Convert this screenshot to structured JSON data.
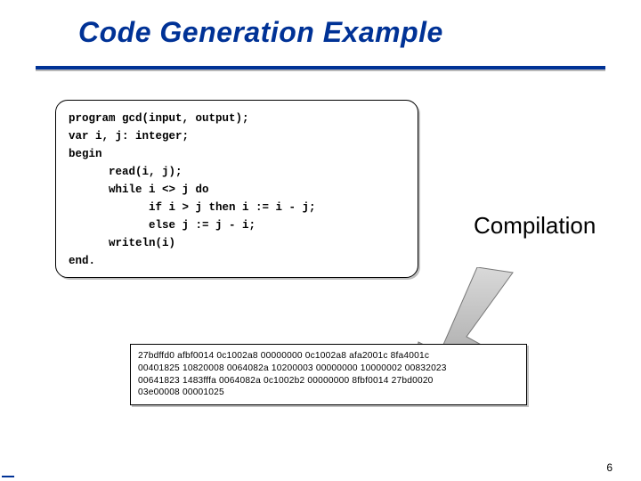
{
  "title": "Code Generation Example",
  "code": {
    "l1": "program gcd(input, output);",
    "l2": "var i, j: integer;",
    "l3": "begin",
    "l4": "      read(i, j);",
    "l5": "      while i <> j do",
    "l6": "            if i > j then i := i - j;",
    "l7": "            else j := j - i;",
    "l8": "      writeln(i)",
    "l9": "end."
  },
  "arrow_label": "Compilation",
  "hex": {
    "r1": "27bdffd0 afbf0014 0c1002a8 00000000 0c1002a8 afa2001c 8fa4001c",
    "r2": "00401825 10820008 0064082a 10200003 00000000 10000002 00832023",
    "r3": "00641823 1483fffa 0064082a 0c1002b2 00000000 8fbf0014 27bd0020",
    "r4": "03e00008 00001025"
  },
  "page_number": "6"
}
